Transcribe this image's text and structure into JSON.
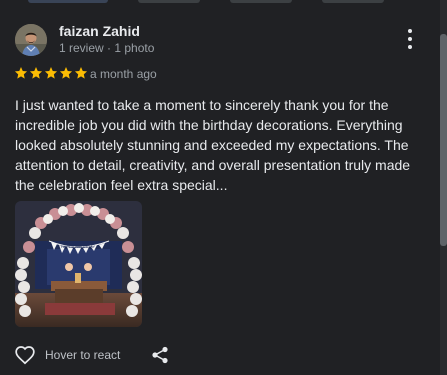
{
  "review": {
    "author": "faizan Zahid",
    "meta": "1 review · 1 photo",
    "rating": 5,
    "time": "a month ago",
    "text": "I just wanted to take a moment to sincerely thank you for the incredible job you did with the birthday decorations. Everything looked absolutely stunning and exceeded my expectations. The attention to detail, creativity, and overall presentation truly made the celebration feel extra special...",
    "photo_banner": "HAPPY BIRTHDAY",
    "like_label": "Hover to react"
  },
  "icons": {
    "menu": "more-vert-icon",
    "star": "star-icon",
    "heart": "heart-outline-icon",
    "share": "share-icon"
  },
  "colors": {
    "background": "#202124",
    "text": "#e8eaed",
    "secondary_text": "#9aa0a6",
    "star": "#fbbc04"
  }
}
